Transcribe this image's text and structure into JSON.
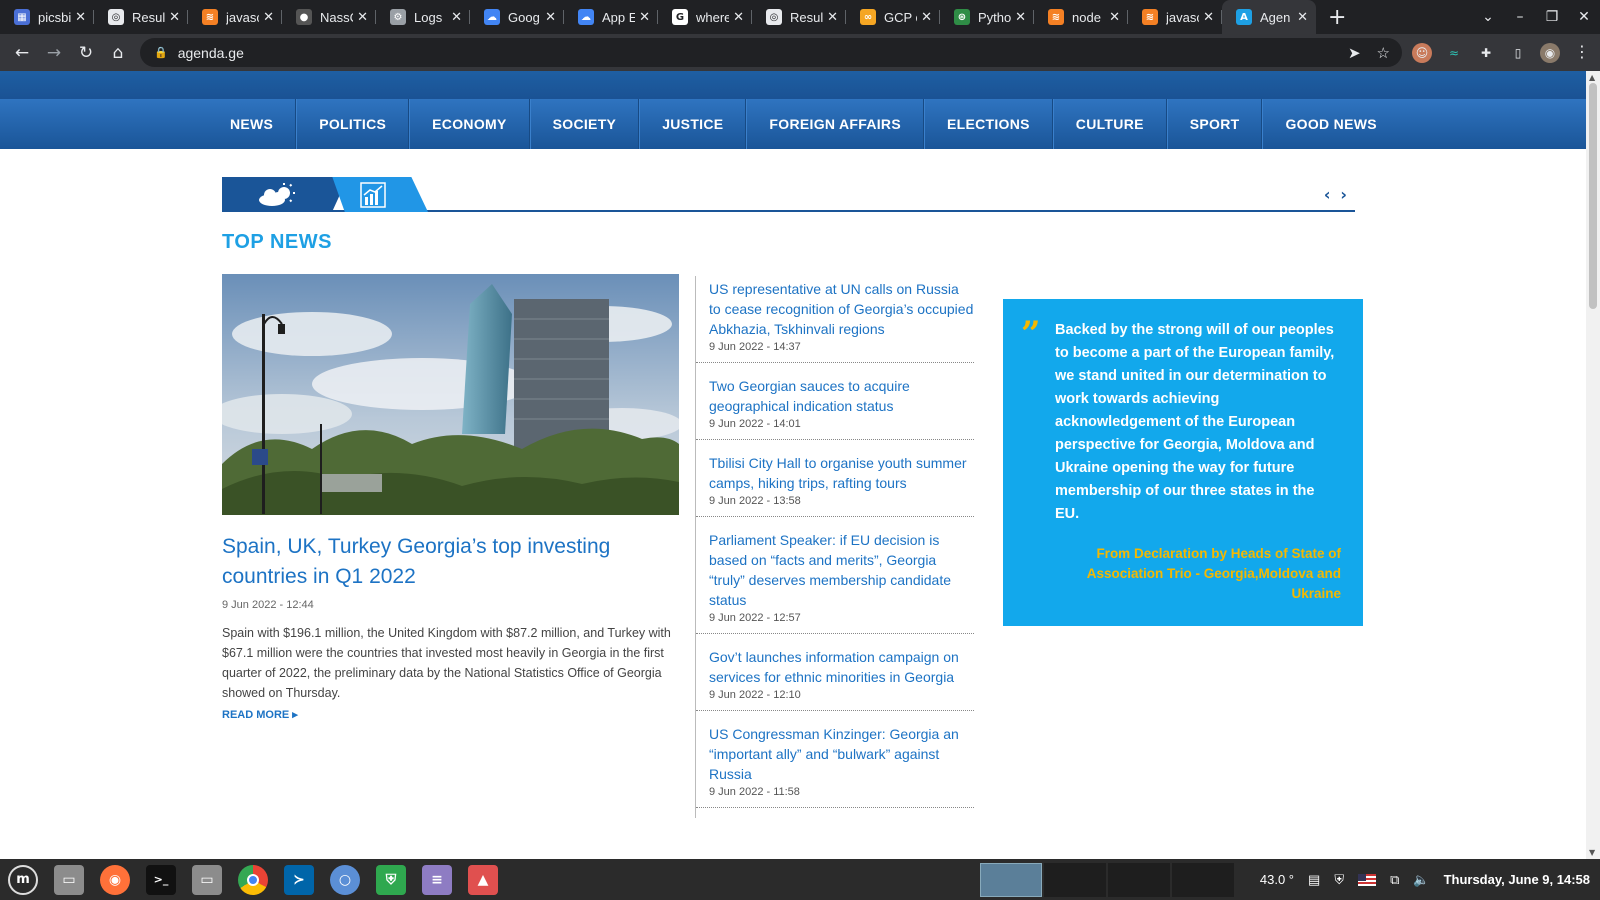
{
  "browser": {
    "tabs": [
      {
        "title": "picsbi",
        "color": "#4a6fd6",
        "glyph": "▦"
      },
      {
        "title": "Result",
        "color": "#e8eaed",
        "glyph": "◎"
      },
      {
        "title": "javasc",
        "color": "#f48024",
        "glyph": "≋"
      },
      {
        "title": "NassC",
        "color": "#555555",
        "glyph": "●"
      },
      {
        "title": "Logs",
        "color": "#9aa0a6",
        "glyph": "⚙"
      },
      {
        "title": "Goog",
        "color": "#4285f4",
        "glyph": "☁"
      },
      {
        "title": "App E",
        "color": "#4285f4",
        "glyph": "☁"
      },
      {
        "title": "where",
        "color": "#ffffff",
        "glyph": "G"
      },
      {
        "title": "Result",
        "color": "#e8eaed",
        "glyph": "◎"
      },
      {
        "title": "GCP c",
        "color": "#f5a623",
        "glyph": "∞"
      },
      {
        "title": "Pytho",
        "color": "#2f8d46",
        "glyph": "⊛"
      },
      {
        "title": "node",
        "color": "#f48024",
        "glyph": "≋"
      },
      {
        "title": "javasc",
        "color": "#f48024",
        "glyph": "≋"
      },
      {
        "title": "Agen",
        "color": "#1ea0e4",
        "glyph": "A"
      }
    ],
    "url": "agenda.ge",
    "new_tab_glyph": "+"
  },
  "nav": {
    "items": [
      "NEWS",
      "POLITICS",
      "ECONOMY",
      "SOCIETY",
      "JUSTICE",
      "FOREIGN AFFAIRS",
      "ELECTIONS",
      "CULTURE",
      "SPORT",
      "GOOD NEWS"
    ]
  },
  "section_title": "TOP NEWS",
  "lead": {
    "title": "Spain, UK, Turkey Georgia’s top investing countries in Q1 2022",
    "date": "9 Jun 2022 - 12:44",
    "body": "Spain with $196.1 million, the United Kingdom with $87.2 million, and Turkey with $67.1 million were the countries that invested most heavily in Georgia in the first quarter of 2022, the preliminary data by the National Statistics Office of Georgia showed on Thursday.",
    "read_more": "READ MORE ▸"
  },
  "news": [
    {
      "title": "US representative at UN calls on Russia to cease recognition of Georgia’s occupied Abkhazia, Tskhinvali regions",
      "date": "9 Jun 2022 - 14:37"
    },
    {
      "title": "Two Georgian sauces to acquire geographical indication status",
      "date": "9 Jun 2022 - 14:01"
    },
    {
      "title": "Tbilisi City Hall to organise youth summer camps, hiking trips, rafting tours",
      "date": "9 Jun 2022 - 13:58"
    },
    {
      "title": "Parliament Speaker: if EU decision is based on “facts and merits”, Georgia “truly” deserves membership candidate status",
      "date": "9 Jun 2022 - 12:57"
    },
    {
      "title": "Gov’t launches information campaign on services for ethnic minorities in Georgia",
      "date": "9 Jun 2022 - 12:10"
    },
    {
      "title": "US Congressman Kinzinger: Georgia an “important ally” and “bulwark” against Russia",
      "date": "9 Jun 2022 - 11:58"
    }
  ],
  "quote": {
    "mark": "”",
    "text": "Backed by the strong will of our peoples to become a part of the European family, we stand united in our determination to work towards achieving acknowledgement of the European perspective for Georgia, Moldova and Ukraine opening the way for future membership of our three states in the EU.",
    "source": "From Declaration by Heads of State of Association Trio - Georgia,Moldova and Ukraine"
  },
  "taskbar": {
    "temperature": "43.0 °",
    "clock": "Thursday, June 9, 14:58"
  },
  "colors": {
    "accent": "#1ea0e4",
    "nav_blue": "#1a5598",
    "link_blue": "#1d73c4",
    "quote_bg": "#12a8ec",
    "quote_gold": "#f5b800"
  }
}
